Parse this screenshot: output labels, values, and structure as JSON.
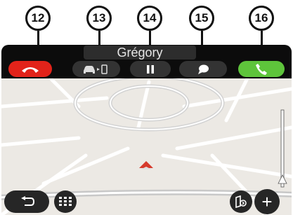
{
  "callouts": [
    "12",
    "13",
    "14",
    "15",
    "16"
  ],
  "call_bar": {
    "caller_name": "Grégory",
    "buttons": [
      {
        "name": "hang-up",
        "icon": "phone-hangup-icon",
        "color": "#e2231a"
      },
      {
        "name": "transfer-to-phone",
        "icon": "car-to-phone-icon",
        "color": "#333333"
      },
      {
        "name": "hold",
        "icon": "pause-icon",
        "color": "#333333"
      },
      {
        "name": "message",
        "icon": "speech-bubble-icon",
        "color": "#333333"
      },
      {
        "name": "answer",
        "icon": "phone-icon",
        "color": "#5ec43b"
      }
    ]
  },
  "map_controls": {
    "back": {
      "icon": "back-arrow-icon"
    },
    "keypad": {
      "icon": "keypad-icon"
    },
    "route": {
      "icon": "route-view-icon"
    },
    "zoom_in": {
      "label": "+",
      "icon": "plus-icon"
    }
  }
}
